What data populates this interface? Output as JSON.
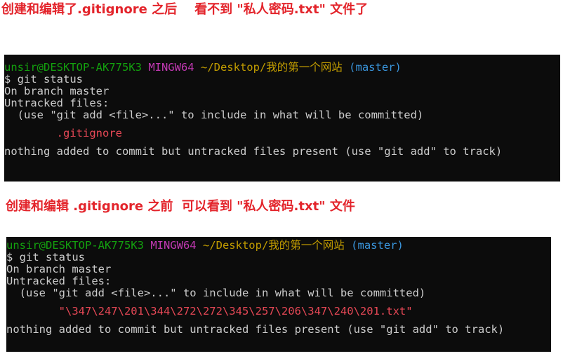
{
  "captions": {
    "after": "创建和编辑了.gitignore 之后    看不到 \"私人密码.txt\" 文件了",
    "before": "创建和编辑 .gitignore 之前  可以看到 \"私人密码.txt\" 文件"
  },
  "terminal_after": {
    "prompt_user": "unsir@DESKTOP-AK775K3",
    "prompt_shell": "MINGW64",
    "prompt_path": "~/Desktop/我的第一个网站",
    "prompt_branch": "(master)",
    "command": "$ git status",
    "line_branch": "On branch master",
    "line_untracked": "Untracked files:",
    "line_hint": "  (use \"git add <file>...\" to include in what will be committed)",
    "untracked_file": "        .gitignore",
    "line_summary": "nothing added to commit but untracked files present (use \"git add\" to track)"
  },
  "terminal_before": {
    "prompt_user": "unsir@DESKTOP-AK775K3",
    "prompt_shell": "MINGW64",
    "prompt_path": "~/Desktop/我的第一个网站",
    "prompt_branch": "(master)",
    "command": "$ git status",
    "line_branch": "On branch master",
    "line_untracked": "Untracked files:",
    "line_hint": "  (use \"git add <file>...\" to include in what will be committed)",
    "untracked_file": "        \"\\347\\247\\201\\344\\272\\272\\345\\257\\206\\347\\240\\201.txt\"",
    "line_summary": "nothing added to commit but untracked files present (use \"git add\" to track)"
  },
  "colors": {
    "caption": "#e3242b",
    "terminal_bg": "#0c0c0c",
    "user": "#13a10e",
    "shell": "#c239b3",
    "path": "#c19c00",
    "branch": "#3a96dd",
    "untracked_file": "#e74856",
    "text": "#cccccc"
  }
}
